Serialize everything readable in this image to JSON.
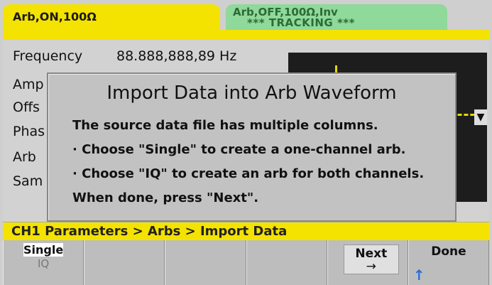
{
  "tabs": {
    "ch1": {
      "label": "Arb,ON,100Ω"
    },
    "ch2": {
      "label": "Arb,OFF,100Ω,Inv",
      "subtitle": "*** TRACKING ***"
    }
  },
  "params": {
    "frequency_label": "Frequency",
    "frequency_value": "88.888,888,89 Hz",
    "partial_labels": [
      "Amp",
      "Offs",
      "Phas",
      "Arb",
      "Sam"
    ]
  },
  "dialog": {
    "title": "Import Data into Arb Waveform",
    "lines": [
      "The source data file has multiple columns.",
      "· Choose \"Single\" to create a one-channel arb.",
      "· Choose \"IQ\" to create an arb for both channels.",
      "When done, press \"Next\"."
    ]
  },
  "breadcrumb": "CH1 Parameters > Arbs > Import Data",
  "softkeys": {
    "single_label": "Single",
    "iq_label": "IQ",
    "next_label": "Next",
    "next_arrow": "→",
    "done_label": "Done",
    "up_arrow": "↑"
  },
  "colors": {
    "ch1_tab": "#f4e200",
    "ch2_tab": "#8fd99a",
    "breadcrumb_bg": "#f4e200"
  }
}
